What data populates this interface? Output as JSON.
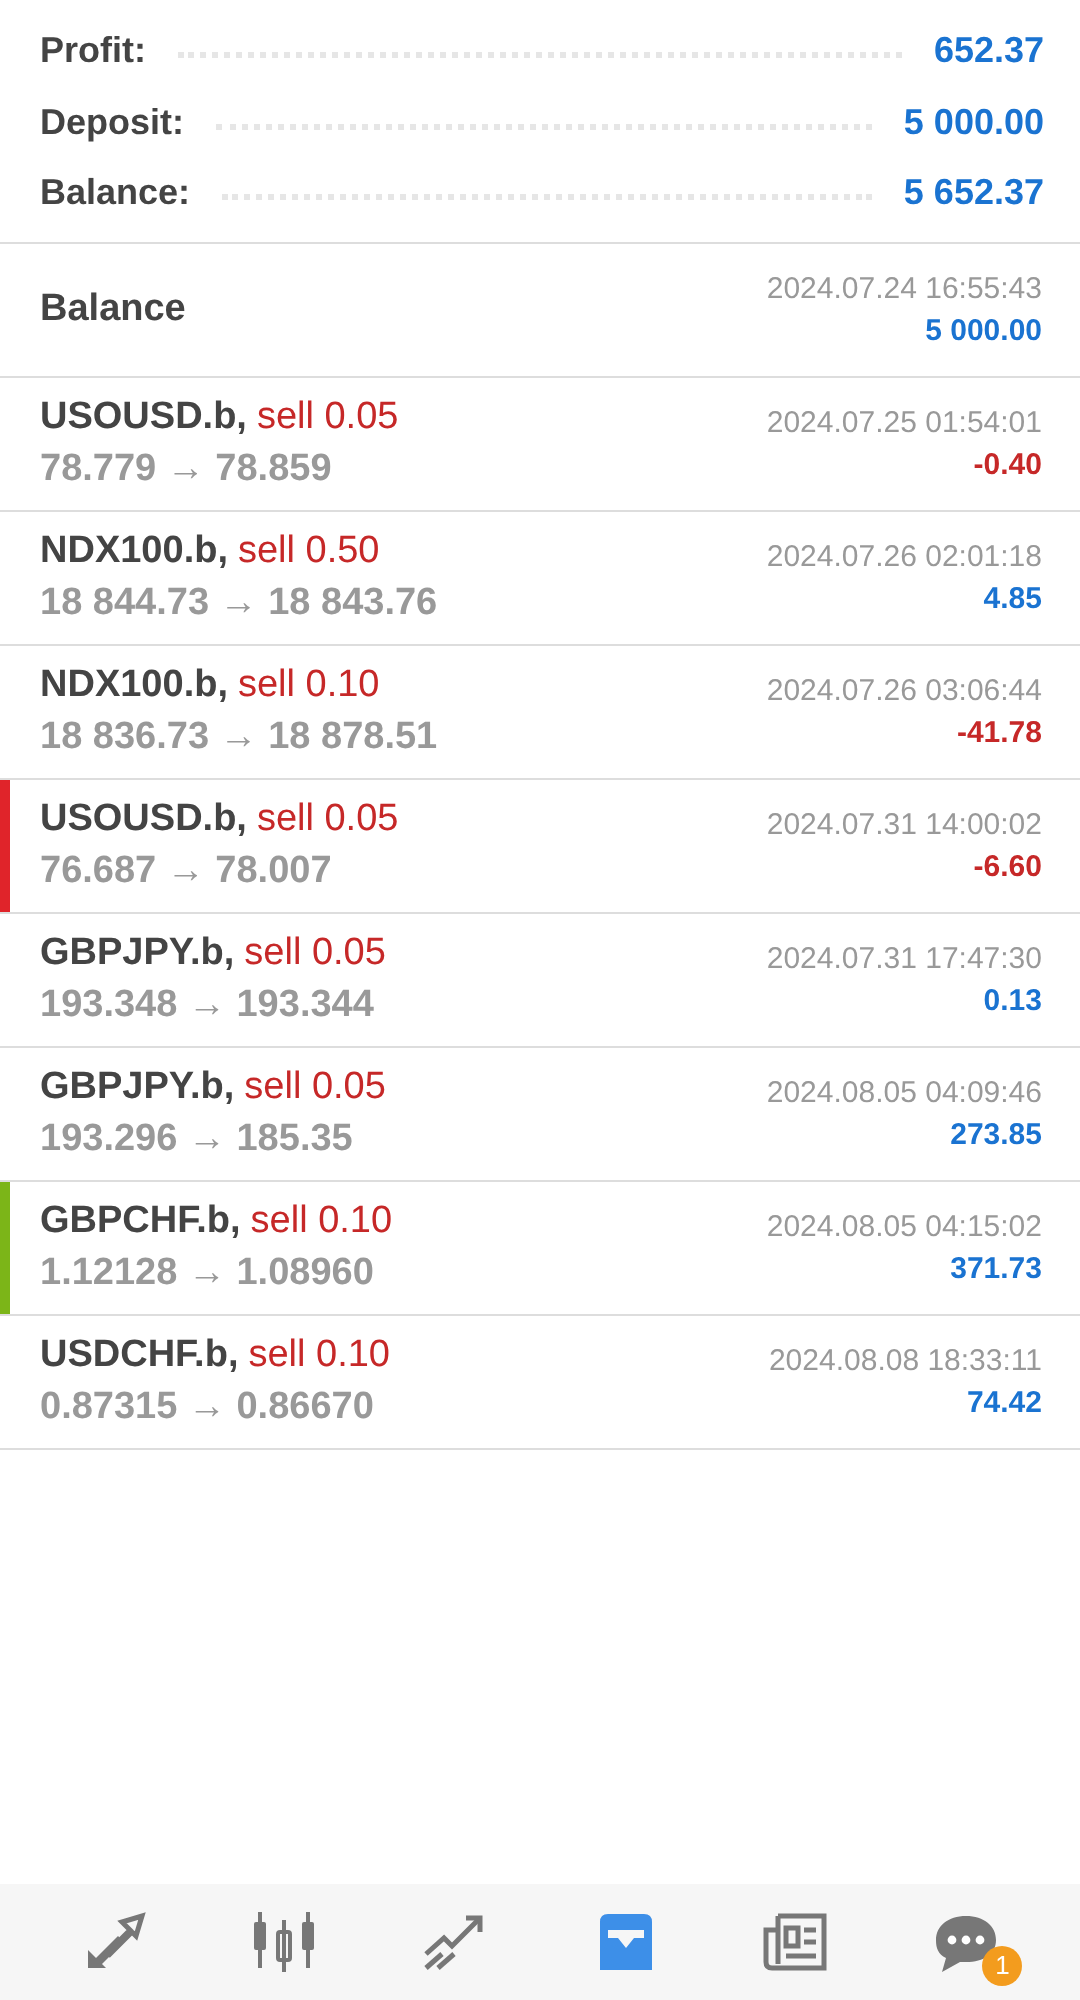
{
  "summary": [
    {
      "label": "Profit:",
      "value": "652.37"
    },
    {
      "label": "Deposit:",
      "value": "5 000.00"
    },
    {
      "label": "Balance:",
      "value": "5 652.37"
    }
  ],
  "balance_entry": {
    "title": "Balance",
    "time": "2024.07.24 16:55:43",
    "amount": "5 000.00"
  },
  "trades": [
    {
      "symbol": "USOUSD.b,",
      "order": "sell 0.05",
      "prices": "78.779 → 78.859",
      "time": "2024.07.25 01:54:01",
      "profit": "-0.40",
      "kind": "loss"
    },
    {
      "symbol": "NDX100.b,",
      "order": "sell 0.50",
      "prices": "18 844.73 → 18 843.76",
      "time": "2024.07.26 02:01:18",
      "profit": "4.85",
      "kind": "gain"
    },
    {
      "symbol": "NDX100.b,",
      "order": "sell 0.10",
      "prices": "18 836.73 → 18 878.51",
      "time": "2024.07.26 03:06:44",
      "profit": "-41.78",
      "kind": "loss"
    },
    {
      "symbol": "USOUSD.b,",
      "order": "sell 0.05",
      "prices": "76.687 → 78.007",
      "time": "2024.07.31 14:00:02",
      "profit": "-6.60",
      "kind": "loss",
      "color": "#e0242a"
    },
    {
      "symbol": "GBPJPY.b,",
      "order": "sell 0.05",
      "prices": "193.348 → 193.344",
      "time": "2024.07.31 17:47:30",
      "profit": "0.13",
      "kind": "gain"
    },
    {
      "symbol": "GBPJPY.b,",
      "order": "sell 0.05",
      "prices": "193.296 → 185.35",
      "time": "2024.08.05 04:09:46",
      "profit": "273.85",
      "kind": "gain"
    },
    {
      "symbol": "GBPCHF.b,",
      "order": "sell 0.10",
      "prices": "1.12128 → 1.08960",
      "time": "2024.08.05 04:15:02",
      "profit": "371.73",
      "kind": "gain",
      "color": "#7cb518"
    },
    {
      "symbol": "USDCHF.b,",
      "order": "sell 0.10",
      "prices": "0.87315 → 0.86670",
      "time": "2024.08.08 18:33:11",
      "profit": "74.42",
      "kind": "gain"
    }
  ],
  "nav": [
    {
      "kind": "trade",
      "selected": false
    },
    {
      "kind": "quotes",
      "selected": false
    },
    {
      "kind": "chart",
      "selected": false
    },
    {
      "kind": "history",
      "selected": true
    },
    {
      "kind": "news",
      "selected": false
    },
    {
      "kind": "chat",
      "selected": false,
      "badge": "1"
    }
  ]
}
